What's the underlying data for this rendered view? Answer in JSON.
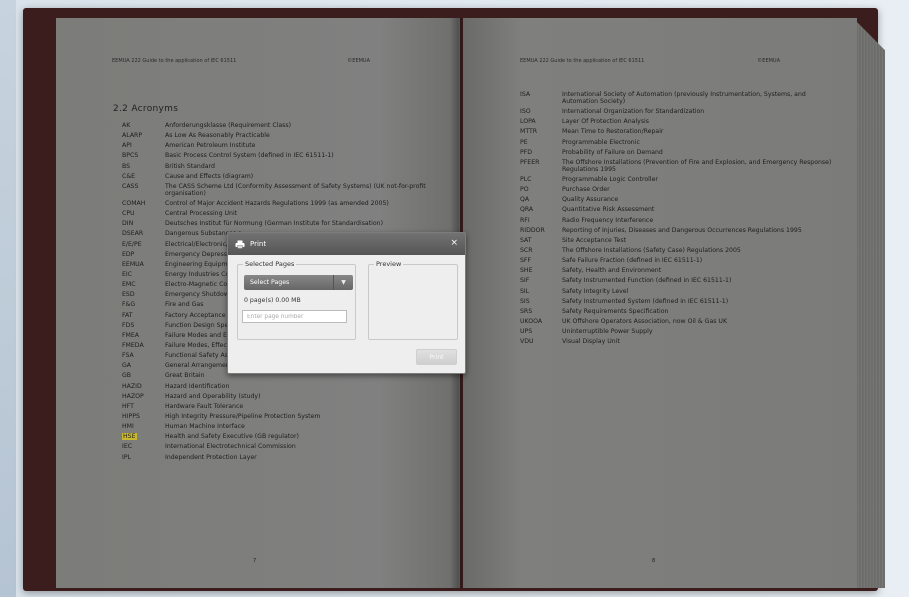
{
  "colors": {
    "book_cover": "#3b1d1d",
    "page_dimmed": "#7b7b79",
    "highlight": "#c9b82d",
    "dialog_title_bg": "#5e5e5e"
  },
  "left_page": {
    "header_left": "EEMUA 222 Guide to the application of IEC 61511",
    "header_right": "©EEMUA",
    "section_title": "2.2  Acronyms",
    "page_number": "7",
    "acronyms": [
      {
        "abbr": "AK",
        "def": "Anforderungsklasse (Requirement Class)"
      },
      {
        "abbr": "ALARP",
        "def": "As Low As Reasonably Practicable"
      },
      {
        "abbr": "API",
        "def": "American Petroleum Institute"
      },
      {
        "abbr": "BPCS",
        "def": "Basic Process Control System (defined in IEC 61511-1)"
      },
      {
        "abbr": "BS",
        "def": "British Standard"
      },
      {
        "abbr": "C&E",
        "def": "Cause and Effects (diagram)"
      },
      {
        "abbr": "CASS",
        "def": "The CASS Scheme Ltd (Conformity Assessment of Safety Systems) (UK not-for-profit organisation)"
      },
      {
        "abbr": "COMAH",
        "def": "Control of Major Accident Hazards Regulations 1999 (as amended 2005)"
      },
      {
        "abbr": "CPU",
        "def": "Central Processing Unit"
      },
      {
        "abbr": "DIN",
        "def": "Deutsches Institut für Normung (German Institute for Standardisation)"
      },
      {
        "abbr": "DSEAR",
        "def": "Dangerous Substances a"
      },
      {
        "abbr": "E/E/PE",
        "def": "Electrical/Electronic/Progr"
      },
      {
        "abbr": "EDP",
        "def": "Emergency Depressurisa"
      },
      {
        "abbr": "EEMUA",
        "def": "Engineering Equipment a"
      },
      {
        "abbr": "EIC",
        "def": "Energy Industries Counci"
      },
      {
        "abbr": "EMC",
        "def": "Electro-Magnetic Compat"
      },
      {
        "abbr": "ESD",
        "def": "Emergency Shutdown"
      },
      {
        "abbr": "F&G",
        "def": "Fire and Gas"
      },
      {
        "abbr": "FAT",
        "def": "Factory Acceptance Test"
      },
      {
        "abbr": "FDS",
        "def": "Function Design Specifica"
      },
      {
        "abbr": "FMEA",
        "def": "Failure Modes and Effects"
      },
      {
        "abbr": "FMEDA",
        "def": "Failure Modes, Effects an"
      },
      {
        "abbr": "FSA",
        "def": "Functional Safety Assessment (defined in IEC 61511-1)"
      },
      {
        "abbr": "GA",
        "def": "General Arrangement (drawing)"
      },
      {
        "abbr": "GB",
        "def": "Great Britain"
      },
      {
        "abbr": "HAZID",
        "def": "Hazard Identification"
      },
      {
        "abbr": "HAZOP",
        "def": "Hazard and Operability (study)"
      },
      {
        "abbr": "HFT",
        "def": "Hardware Fault Tolerance"
      },
      {
        "abbr": "HIPPS",
        "def": "High Integrity Pressure/Pipeline Protection System"
      },
      {
        "abbr": "HMI",
        "def": "Human Machine Interface"
      },
      {
        "abbr": "HSE",
        "def": "Health and Safety Executive (GB regulator)",
        "highlight": true
      },
      {
        "abbr": "IEC",
        "def": "International Electrotechnical Commission"
      },
      {
        "abbr": "IPL",
        "def": "Independent Protection Layer"
      }
    ]
  },
  "right_page": {
    "header_left": "EEMUA 222 Guide to the application of IEC 61511",
    "header_right": "©EEMUA",
    "page_number": "8",
    "acronyms": [
      {
        "abbr": "ISA",
        "def": "International Society of Automation (previously Instrumentation, Systems, and Automation Society)"
      },
      {
        "abbr": "ISO",
        "def": "International Organization for Standardization"
      },
      {
        "abbr": "LOPA",
        "def": "Layer Of Protection Analysis"
      },
      {
        "abbr": "MTTR",
        "def": "Mean Time to Restoration/Repair"
      },
      {
        "abbr": "PE",
        "def": "Programmable Electronic"
      },
      {
        "abbr": "PFD",
        "def": "Probability of Failure on Demand"
      },
      {
        "abbr": "PFEER",
        "def": "The Offshore Installations (Prevention of Fire and Explosion, and Emergency Response) Regulations 1995"
      },
      {
        "abbr": "PLC",
        "def": "Programmable Logic Controller"
      },
      {
        "abbr": "PO",
        "def": "Purchase Order"
      },
      {
        "abbr": "QA",
        "def": "Quality Assurance"
      },
      {
        "abbr": "QRA",
        "def": "Quantitative Risk Assessment"
      },
      {
        "abbr": "RFI",
        "def": "Radio Frequency Interference"
      },
      {
        "abbr": "RIDDOR",
        "def": "Reporting of Injuries, Diseases and Dangerous Occurrences Regulations 1995"
      },
      {
        "abbr": "SAT",
        "def": "Site Acceptance Test"
      },
      {
        "abbr": "SCR",
        "def": "The Offshore Installations (Safety Case) Regulations 2005"
      },
      {
        "abbr": "SFF",
        "def": "Safe Failure Fraction (defined in IEC 61511-1)"
      },
      {
        "abbr": "SHE",
        "def": "Safety, Health and Environment"
      },
      {
        "abbr": "SIF",
        "def": "Safety Instrumented Function (defined in IEC 61511-1)"
      },
      {
        "abbr": "SIL",
        "def": "Safety Integrity Level"
      },
      {
        "abbr": "SIS",
        "def": "Safety Instrumented System (defined in IEC 61511-1)"
      },
      {
        "abbr": "SRS",
        "def": "Safety Requirements Specification"
      },
      {
        "abbr": "UKOOA",
        "def": "UK Offshore Operators Association, now Oil & Gas UK"
      },
      {
        "abbr": "UPS",
        "def": "Uninterruptible Power Supply"
      },
      {
        "abbr": "VDU",
        "def": "Visual Display Unit"
      }
    ]
  },
  "print_dialog": {
    "title": "Print",
    "close_glyph": "×",
    "selected_pages_legend": "Selected Pages",
    "preview_legend": "Preview",
    "select_value": "Select Pages",
    "select_arrow_glyph": "▼",
    "pages_info": "0 page(s) 0.00 MB",
    "page_input_placeholder": "Enter page number",
    "print_button": "Print"
  }
}
